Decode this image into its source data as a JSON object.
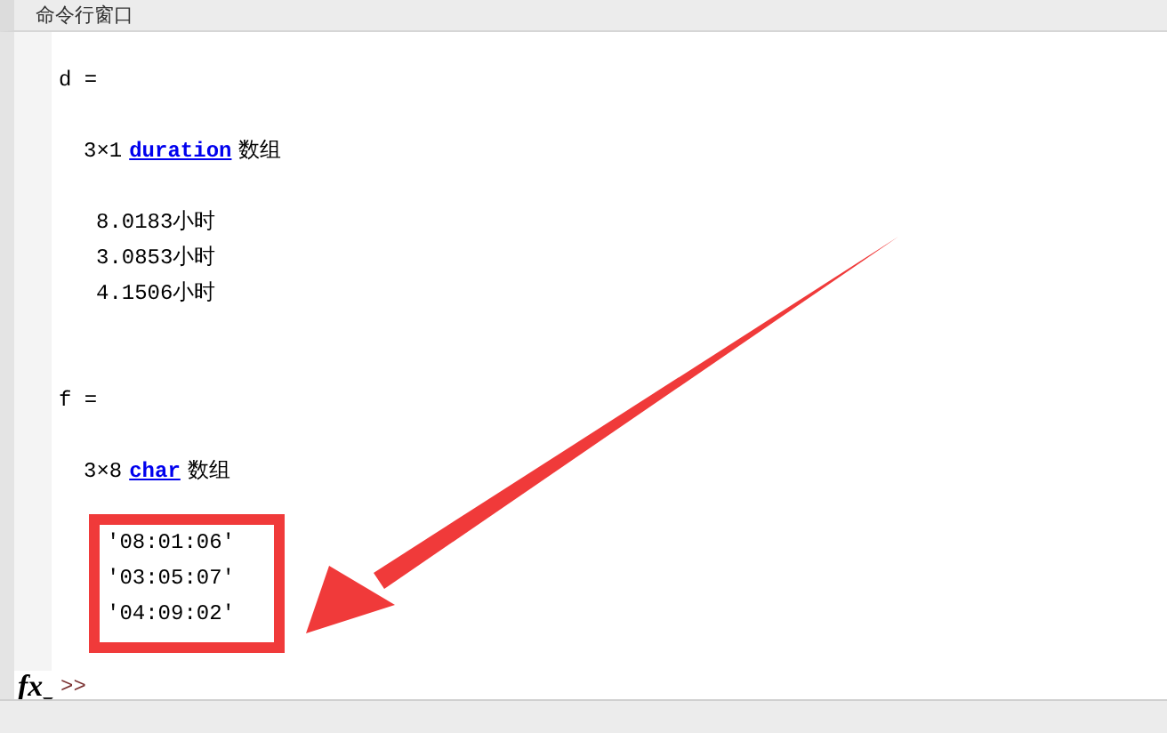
{
  "window": {
    "title": "命令行窗口"
  },
  "output": [
    {
      "kind": "var",
      "text": "d ="
    },
    {
      "kind": "blank"
    },
    {
      "kind": "size",
      "size": "3×1",
      "class": "duration",
      "suffix": "数组"
    },
    {
      "kind": "blank"
    },
    {
      "kind": "value",
      "text": "8.0183小时"
    },
    {
      "kind": "value",
      "text": "3.0853小时"
    },
    {
      "kind": "value",
      "text": "4.1506小时"
    },
    {
      "kind": "blank"
    },
    {
      "kind": "blank"
    },
    {
      "kind": "var",
      "text": "f ="
    },
    {
      "kind": "blank"
    },
    {
      "kind": "size",
      "size": "3×8",
      "class": "char",
      "suffix": "数组"
    },
    {
      "kind": "blank"
    },
    {
      "kind": "boxed",
      "children": [
        {
          "kind": "value",
          "text": "'08:01:06'"
        },
        {
          "kind": "value",
          "text": "'03:05:07'"
        },
        {
          "kind": "value",
          "text": "'04:09:02'"
        }
      ]
    }
  ],
  "prompt": {
    "icon": "fx",
    "text": ">>"
  }
}
